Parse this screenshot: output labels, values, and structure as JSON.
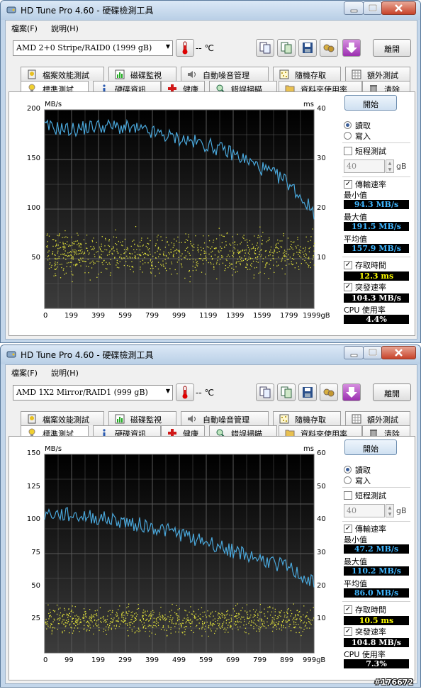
{
  "colors": {
    "transfer_line": "#4aa8dc",
    "access_dots": "#e0e03a",
    "plot_bg_top": "#000000",
    "plot_bg_bottom": "#3c3c3c",
    "grid": "#5a5a5a"
  },
  "windows": [
    {
      "title": "HD Tune Pro 4.60 - 硬碟檢測工具",
      "menu": [
        "檔案(F)",
        "說明(H)"
      ],
      "drive": "AMD    2+0 Stripe/RAID0 (1999 gB)",
      "temperature": "-- ℃",
      "exit_label": "離開",
      "tabs_top": [
        "檔案效能測試",
        "磁碟監視",
        "自動噪音管理",
        "隨機存取",
        "額外測試"
      ],
      "tabs_bottom": [
        "標準測試",
        "硬碟資訊",
        "健康",
        "錯誤掃瞄",
        "資料夾使用率",
        "清除"
      ],
      "start_label": "開始",
      "read_label": "讀取",
      "write_label": "寫入",
      "short_test_label": "短程測試",
      "short_test_value": "40",
      "gb_unit": "gB",
      "transfer_label": "傳輸速率",
      "min_label": "最小值",
      "min_value": "94.3 MB/s",
      "max_label": "最大值",
      "max_value": "191.5 MB/s",
      "avg_label": "平均值",
      "avg_value": "157.9 MB/s",
      "access_label": "存取時間",
      "access_value": "12.3 ms",
      "burst_label": "突發速率",
      "burst_value": "104.3 MB/s",
      "cpu_label": "CPU 使用率",
      "cpu_value": "4.4%",
      "chart_unit_left": "MB/s",
      "chart_unit_right": "ms"
    },
    {
      "title": "HD Tune Pro 4.60 - 硬碟檢測工具",
      "menu": [
        "檔案(F)",
        "說明(H)"
      ],
      "drive": "AMD    1X2 Mirror/RAID1 (999 gB)",
      "temperature": "-- ℃",
      "exit_label": "離開",
      "tabs_top": [
        "檔案效能測試",
        "磁碟監視",
        "自動噪音管理",
        "隨機存取",
        "額外測試"
      ],
      "tabs_bottom": [
        "標準測試",
        "硬碟資訊",
        "健康",
        "錯誤掃瞄",
        "資料夾使用率",
        "清除"
      ],
      "start_label": "開始",
      "read_label": "讀取",
      "write_label": "寫入",
      "short_test_label": "短程測試",
      "short_test_value": "40",
      "gb_unit": "gB",
      "transfer_label": "傳輸速率",
      "min_label": "最小值",
      "min_value": "47.2 MB/s",
      "max_label": "最大值",
      "max_value": "110.2 MB/s",
      "avg_label": "平均值",
      "avg_value": "86.0 MB/s",
      "access_label": "存取時間",
      "access_value": "10.5 ms",
      "burst_label": "突發速率",
      "burst_value": "104.8 MB/s",
      "cpu_label": "CPU 使用率",
      "cpu_value": "7.3%",
      "chart_unit_left": "MB/s",
      "chart_unit_right": "ms"
    }
  ],
  "chart_data": [
    {
      "type": "line",
      "series": [
        {
          "name": "",
          "x": [
            0,
            199,
            399,
            599,
            799,
            999,
            1199,
            1399,
            1599,
            1799,
            1999
          ],
          "values": [
            183,
            180,
            184,
            182,
            177,
            171,
            165,
            156,
            142,
            128,
            97
          ]
        }
      ],
      "scatter_ms_range": [
        5,
        17
      ],
      "xlabel": "",
      "ylabel": "MB/s",
      "y2label": "ms",
      "x_ticks": [
        "0",
        "199",
        "399",
        "599",
        "799",
        "999",
        "1199",
        "1399",
        "1599",
        "1799",
        "1999gB"
      ],
      "y_ticks": [
        50,
        100,
        150,
        200
      ],
      "y2_ticks": [
        10,
        20,
        30,
        40
      ],
      "xlim": [
        0,
        1999
      ],
      "ylim": [
        0,
        200
      ],
      "y2lim": [
        0,
        40
      ],
      "grid": true
    },
    {
      "type": "line",
      "series": [
        {
          "name": "",
          "x": [
            0,
            99,
            199,
            299,
            399,
            499,
            599,
            699,
            799,
            899,
            999
          ],
          "values": [
            105,
            104,
            102,
            99,
            95,
            90,
            84,
            77,
            71,
            65,
            52
          ]
        }
      ],
      "scatter_ms_range": [
        4,
        16
      ],
      "xlabel": "",
      "ylabel": "MB/s",
      "y2label": "ms",
      "x_ticks": [
        "0",
        "99",
        "199",
        "299",
        "399",
        "499",
        "599",
        "699",
        "799",
        "899",
        "999gB"
      ],
      "y_ticks": [
        25,
        50,
        75,
        100,
        125,
        150
      ],
      "y2_ticks": [
        10,
        20,
        30,
        40,
        50,
        60
      ],
      "xlim": [
        0,
        999
      ],
      "ylim": [
        0,
        150
      ],
      "y2lim": [
        0,
        60
      ],
      "grid": true
    }
  ],
  "watermark": "#176672"
}
